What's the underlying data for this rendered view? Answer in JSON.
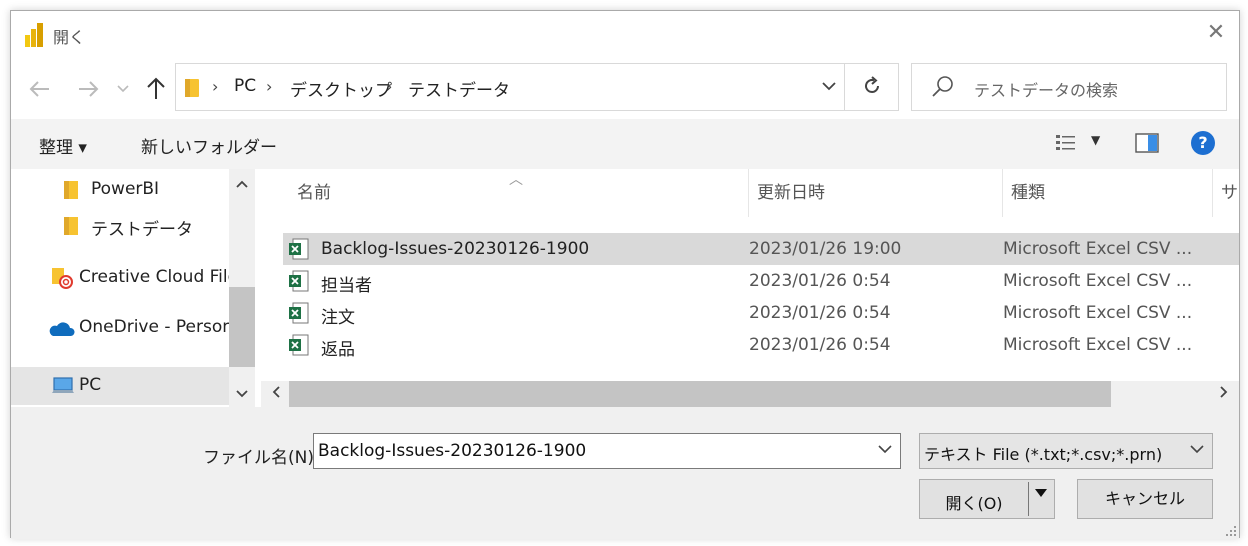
{
  "window": {
    "title": "開く",
    "close_symbol": "✕"
  },
  "nav": {
    "back_icon": "arrow-left-icon",
    "forward_icon": "arrow-right-icon",
    "up_icon": "arrow-up-icon"
  },
  "address": {
    "crumbs": [
      "PC",
      "デスクトップ",
      "テストデータ"
    ]
  },
  "search": {
    "placeholder": "テストデータの検索"
  },
  "toolbar": {
    "organize": "整理 ▾",
    "new_folder": "新しいフォルダー",
    "help": "?"
  },
  "nav_pane": {
    "items": [
      {
        "label": "PowerBI",
        "icon": "folder-icon"
      },
      {
        "label": "テストデータ",
        "icon": "folder-icon"
      },
      {
        "label": "Creative Cloud Files",
        "icon": "creative-cloud-icon"
      },
      {
        "label": "OneDrive - Personal",
        "icon": "onedrive-icon"
      },
      {
        "label": "PC",
        "icon": "pc-icon"
      }
    ]
  },
  "file_list": {
    "columns": [
      "名前",
      "更新日時",
      "種類",
      "サイ"
    ],
    "rows": [
      {
        "name": "Backlog-Issues-20230126-1900",
        "date": "2023/01/26 19:00",
        "type": "Microsoft Excel CSV ...",
        "selected": true
      },
      {
        "name": "担当者",
        "date": "2023/01/26 0:54",
        "type": "Microsoft Excel CSV ...",
        "selected": false
      },
      {
        "name": "注文",
        "date": "2023/01/26 0:54",
        "type": "Microsoft Excel CSV ...",
        "selected": false
      },
      {
        "name": "返品",
        "date": "2023/01/26 0:54",
        "type": "Microsoft Excel CSV ...",
        "selected": false
      }
    ]
  },
  "footer": {
    "filename_label": "ファイル名(N):",
    "filename_value": "Backlog-Issues-20230126-1900",
    "filetype_value": "テキスト File (*.txt;*.csv;*.prn)",
    "open_label": "開く(O)",
    "cancel_label": "キャンセル"
  },
  "colors": {
    "accent": "#1d6fd1",
    "folder": "#f7c331",
    "excel": "#1e7145",
    "selected_row": "#d9d9d9"
  }
}
